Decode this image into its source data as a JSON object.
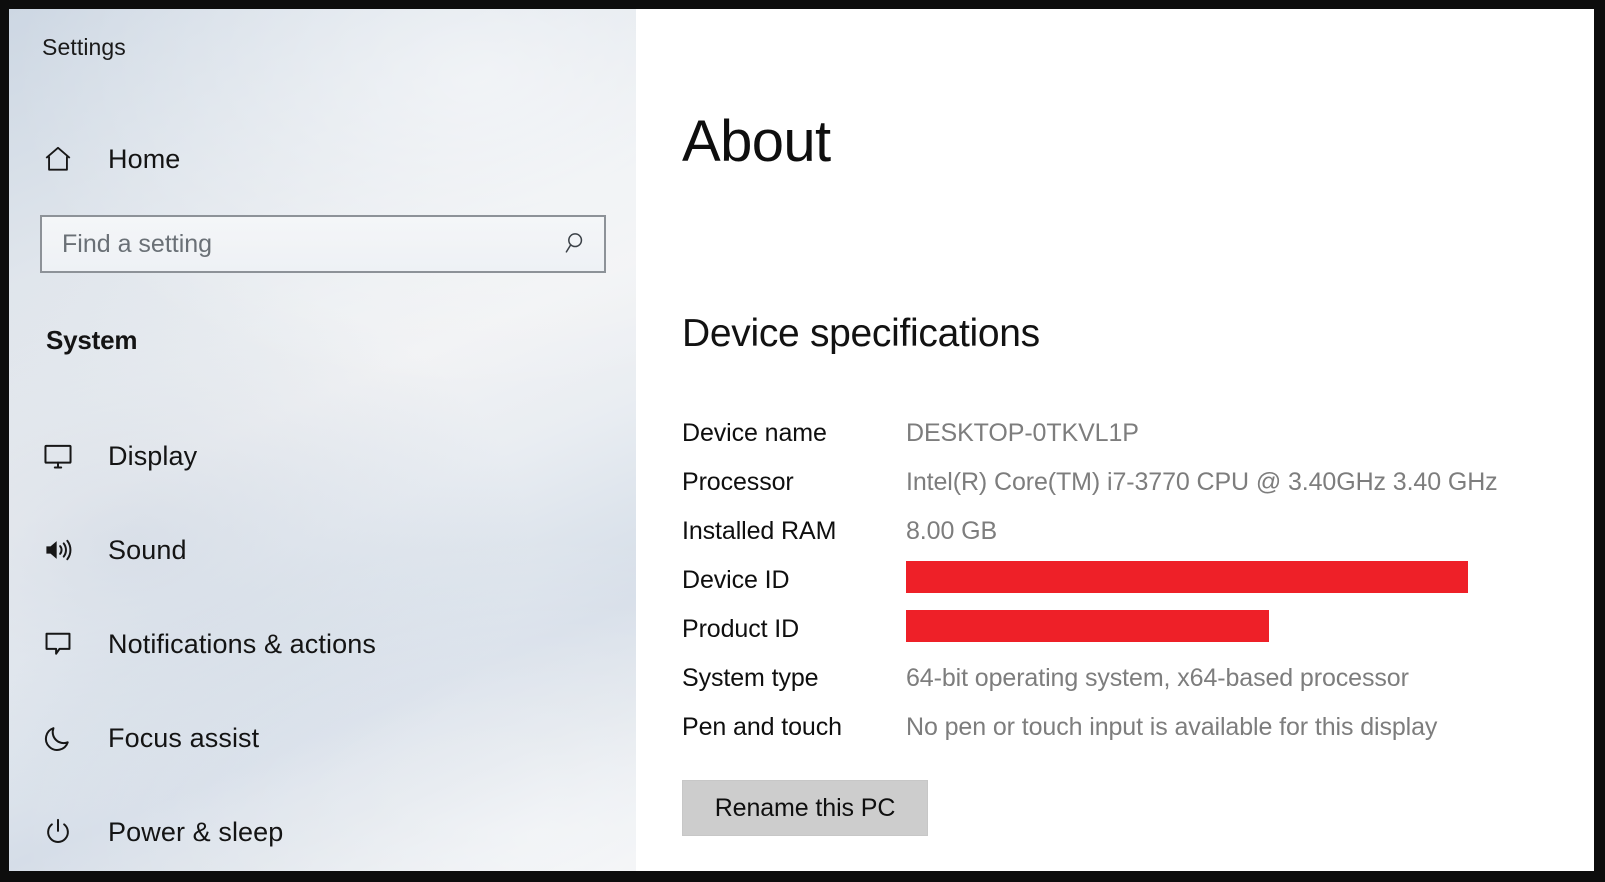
{
  "window": {
    "app_title": "Settings"
  },
  "sidebar": {
    "home": {
      "label": "Home",
      "icon": "home-icon"
    },
    "search": {
      "placeholder": "Find a setting",
      "value": "",
      "icon": "search-icon"
    },
    "section_header": "System",
    "items": [
      {
        "label": "Display",
        "icon": "monitor-icon"
      },
      {
        "label": "Sound",
        "icon": "speaker-icon"
      },
      {
        "label": "Notifications & actions",
        "icon": "chat-bubble-icon"
      },
      {
        "label": "Focus assist",
        "icon": "moon-icon"
      },
      {
        "label": "Power & sleep",
        "icon": "power-icon"
      }
    ]
  },
  "main": {
    "page_title": "About",
    "section_title": "Device specifications",
    "specs": [
      {
        "label": "Device name",
        "value": "DESKTOP-0TKVL1P",
        "redacted": false
      },
      {
        "label": "Processor",
        "value": "Intel(R) Core(TM) i7-3770 CPU @ 3.40GHz   3.40 GHz",
        "redacted": false
      },
      {
        "label": "Installed RAM",
        "value": "8.00 GB",
        "redacted": false
      },
      {
        "label": "Device ID",
        "value": "",
        "redacted": true
      },
      {
        "label": "Product ID",
        "value": "",
        "redacted": true
      },
      {
        "label": "System type",
        "value": "64-bit operating system, x64-based processor",
        "redacted": false
      },
      {
        "label": "Pen and touch",
        "value": "No pen or touch input is available for this display",
        "redacted": false
      }
    ],
    "rename_button": "Rename this PC"
  },
  "colors": {
    "redaction": "#ee2028",
    "sidebar_top": "#cdd7e3",
    "accent_text": "#7d7d7d",
    "button_face": "#cdcdcd"
  }
}
